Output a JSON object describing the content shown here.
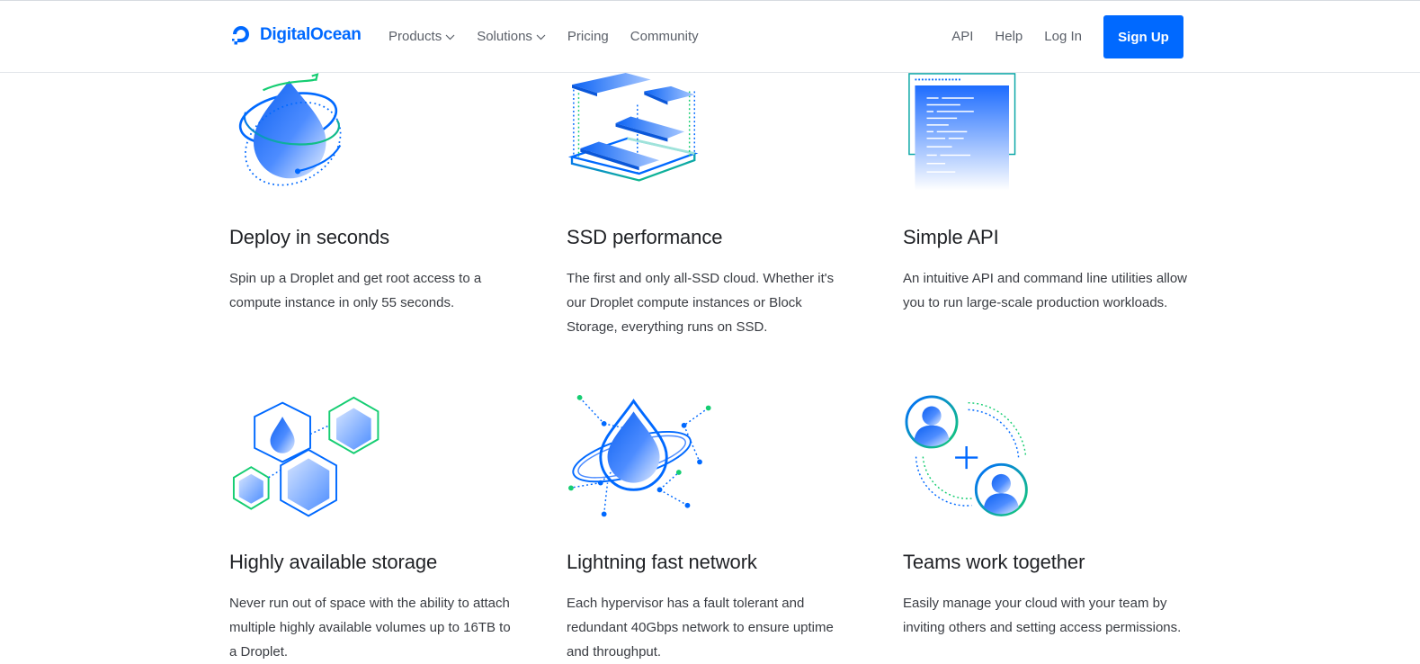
{
  "brand": {
    "name": "DigitalOcean",
    "color": "#0069ff"
  },
  "nav": {
    "left": [
      {
        "label": "Products",
        "dropdown": true
      },
      {
        "label": "Solutions",
        "dropdown": true
      },
      {
        "label": "Pricing",
        "dropdown": false
      },
      {
        "label": "Community",
        "dropdown": false
      }
    ],
    "right": [
      {
        "label": "API"
      },
      {
        "label": "Help"
      },
      {
        "label": "Log In"
      }
    ],
    "signup_label": "Sign Up"
  },
  "features": [
    {
      "title": "Deploy in seconds",
      "text": "Spin up a Droplet and get root access to a compute instance in only 55 seconds.",
      "icon": "droplet-orbit-icon"
    },
    {
      "title": "SSD performance",
      "text": "The first and only all-SSD cloud. Whether it's our Droplet compute instances or Block Storage, everything runs on SSD.",
      "icon": "ssd-stack-icon"
    },
    {
      "title": "Simple API",
      "text": "An intuitive API and command line utilities allow you to run large-scale production workloads.",
      "icon": "api-terminal-icon"
    },
    {
      "title": "Highly available storage",
      "text": "Never run out of space with the ability to attach multiple highly available volumes up to 16TB to a Droplet.",
      "icon": "storage-cubes-icon"
    },
    {
      "title": "Lightning fast network",
      "text": "Each hypervisor has a fault tolerant and redundant 40Gbps network to ensure uptime and throughput.",
      "icon": "network-droplet-icon"
    },
    {
      "title": "Teams work together",
      "text": "Easily manage your cloud with your team by inviting others and setting access permissions.",
      "icon": "team-users-icon"
    }
  ],
  "colors": {
    "accent": "#0069ff",
    "teal": "#15cd72",
    "text": "#24262b"
  }
}
